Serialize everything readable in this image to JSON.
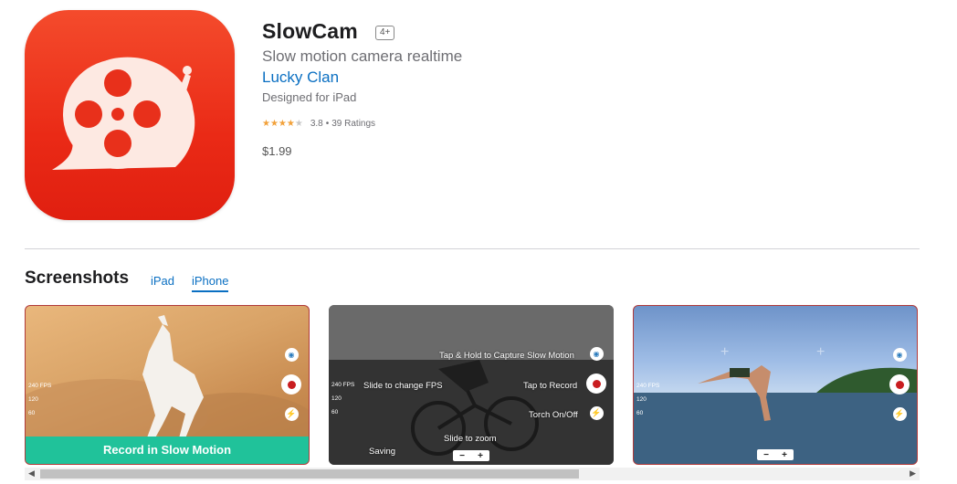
{
  "app": {
    "title": "SlowCam",
    "age_rating": "4+",
    "subtitle": "Slow motion camera realtime",
    "developer": "Lucky Clan",
    "designed_for": "Designed for iPad",
    "rating_value": "3.8",
    "rating_separator": "•",
    "rating_count": "39 Ratings",
    "rating_stars": 3.8,
    "price": "$1.99",
    "icon_color": "#ea2a16"
  },
  "screenshots": {
    "heading": "Screenshots",
    "tabs": [
      {
        "label": "iPad",
        "selected": false
      },
      {
        "label": "iPhone",
        "selected": true
      }
    ],
    "shot1": {
      "banner": "Record in Slow Motion",
      "fps": [
        "240 FPS",
        "120",
        "60"
      ]
    },
    "shot2": {
      "hold_label": "Tap & Hold to Capture Slow Motion",
      "fps_label": "Slide to change FPS",
      "record_label": "Tap to Record",
      "torch_label": "Torch On/Off",
      "zoom_label": "Slide to zoom",
      "saving_label": "Saving",
      "fps": [
        "240 FPS",
        "120",
        "60"
      ],
      "zoom_minus": "−",
      "zoom_plus": "+"
    },
    "shot3": {
      "fps": [
        "240 FPS",
        "120",
        "60"
      ],
      "zoom_minus": "−",
      "zoom_plus": "+"
    }
  },
  "colors": {
    "link": "#0a6fc2",
    "banner": "#20c29a",
    "record": "#c91d20"
  }
}
